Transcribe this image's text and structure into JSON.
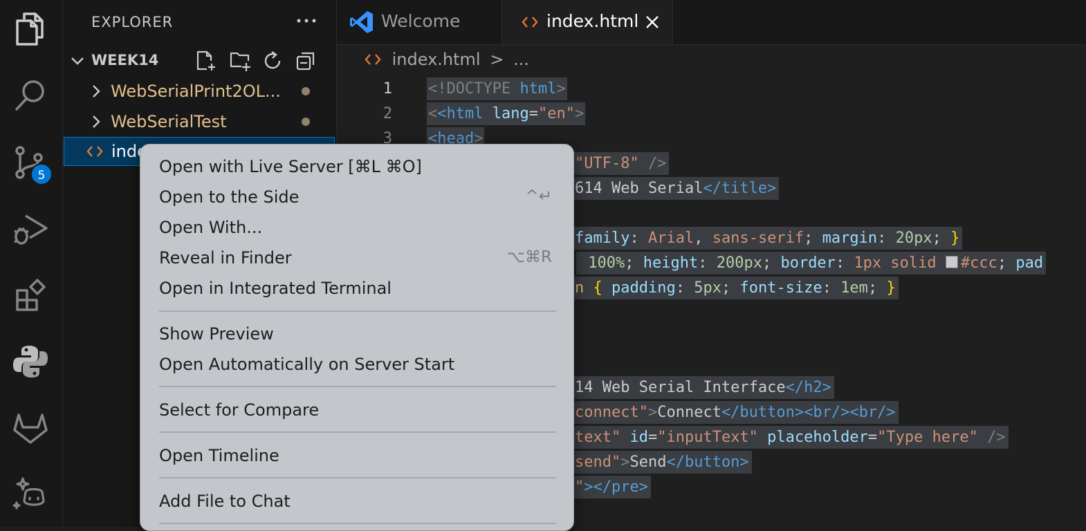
{
  "activity_bar": {
    "items": [
      {
        "name": "explorer-icon"
      },
      {
        "name": "search-icon"
      },
      {
        "name": "source-control-icon",
        "badge": "5"
      },
      {
        "name": "run-debug-icon"
      },
      {
        "name": "extensions-icon"
      },
      {
        "name": "python-icon"
      },
      {
        "name": "gitlab-icon"
      },
      {
        "name": "copilot-icon"
      }
    ]
  },
  "sidebar": {
    "title": "EXPLORER",
    "folder": "WEEK14",
    "items": [
      {
        "label": "WebSerialPrint2OL...",
        "type": "folder"
      },
      {
        "label": "WebSerialTest",
        "type": "folder"
      },
      {
        "label": "inde",
        "type": "file"
      }
    ]
  },
  "tabs": [
    {
      "label": "Welcome"
    },
    {
      "label": "index.html",
      "active": true
    }
  ],
  "breadcrumb": {
    "file": "index.html",
    "sep": ">",
    "rest": "..."
  },
  "editor": {
    "line_numbers": [
      "1",
      "2",
      "3"
    ],
    "lines": {
      "l1_a": "<!DOCTYPE",
      "l1_b": " html",
      "l1_c": ">",
      "l2_a": "<html",
      "l2_b": " lang",
      "l2_c": "=",
      "l2_d": "\"en\"",
      "l2_e": ">",
      "l3_a": "<head",
      "l3_b": ">",
      "l4_a": "\"UTF-8\"",
      "l4_b": " />",
      "l5_a": "614 Web Serial",
      "l5_b": "</title>",
      "l7_a": "family",
      "l7_b": ": ",
      "l7_c": "Arial",
      "l7_d": ", ",
      "l7_e": "sans-serif",
      "l7_f": "; ",
      "l7_g": "margin",
      "l7_h": ": ",
      "l7_i": "20px",
      "l7_j": "; ",
      "l7_k": "}",
      "l8_a": " 100%",
      "l8_b": "; ",
      "l8_c": "height",
      "l8_d": ": ",
      "l8_e": "200px",
      "l8_f": "; ",
      "l8_g": "border",
      "l8_h": ": ",
      "l8_i": "1px solid ",
      "l8_j": "#ccc",
      "l8_k": "; ",
      "l8_l": "pad",
      "l9_a": "n ",
      "l9_b": "{ ",
      "l9_c": "padding",
      "l9_d": ": ",
      "l9_e": "5px",
      "l9_f": "; ",
      "l9_g": "font-size",
      "l9_h": ": ",
      "l9_i": "1em",
      "l9_j": "; ",
      "l9_k": "}",
      "l13_a": "14 Web Serial Interface",
      "l13_b": "</h2>",
      "l14_a": "connect\"",
      "l14_b": ">",
      "l14_c": "Connect",
      "l14_d": "</button><br/><br/>",
      "l15_a": "text\"",
      "l15_b": " id",
      "l15_c": "=",
      "l15_d": "\"inputText\"",
      "l15_e": " placeholder",
      "l15_f": "=",
      "l15_g": "\"Type here\"",
      "l15_h": " />",
      "l16_a": "send\"",
      "l16_b": ">",
      "l16_c": "Send",
      "l16_d": "</button>",
      "l17_a": "\"",
      "l17_b": "></pre>"
    }
  },
  "context_menu": {
    "items": [
      {
        "label": "Open with Live Server [⌘L ⌘O]",
        "shortcut": ""
      },
      {
        "label": "Open to the Side",
        "shortcut": "^↵"
      },
      {
        "label": "Open With...",
        "shortcut": ""
      },
      {
        "label": "Reveal in Finder",
        "shortcut": "⌥⌘R"
      },
      {
        "label": "Open in Integrated Terminal",
        "shortcut": ""
      },
      {
        "label": "Show Preview",
        "shortcut": ""
      },
      {
        "label": "Open Automatically on Server Start",
        "shortcut": ""
      },
      {
        "label": "Select for Compare",
        "shortcut": ""
      },
      {
        "label": "Open Timeline",
        "shortcut": ""
      },
      {
        "label": "Add File to Chat",
        "shortcut": ""
      }
    ]
  },
  "colors": {
    "tag": "#569cd6",
    "attr": "#9cdcfe",
    "string": "#ce9178",
    "number": "#b5cea8",
    "bracket": "#ffd700",
    "folder": "#e2c08d",
    "accent": "#0078d4"
  }
}
